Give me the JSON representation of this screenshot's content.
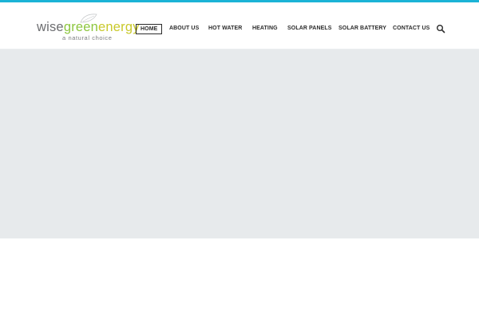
{
  "logo": {
    "word_wise": "wise",
    "word_green": "green",
    "word_energy": "energy",
    "tagline": "a natural choice"
  },
  "nav": {
    "items": [
      {
        "label": "HOME",
        "active": true
      },
      {
        "label": "ABOUT US",
        "active": false
      },
      {
        "label": "HOT WATER",
        "active": false
      },
      {
        "label": "HEATING",
        "active": false
      },
      {
        "label": "SOLAR PANELS",
        "active": false
      },
      {
        "label": "SOLAR BATTERY",
        "active": false
      },
      {
        "label": "CONTACT US",
        "active": false
      }
    ],
    "search_icon": "search-icon"
  },
  "colors": {
    "accent_bar": "#1bb3d6",
    "hero_background": "#e7eaec",
    "logo_wise": "#6d6e71",
    "logo_green": "#8dc63f",
    "logo_energy": "#c9c92b"
  }
}
